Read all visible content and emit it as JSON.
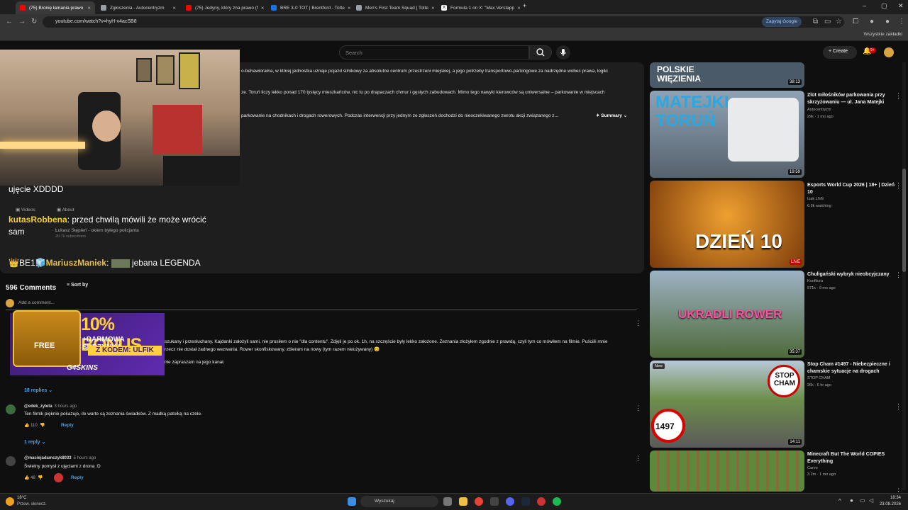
{
  "browser": {
    "tabs": [
      {
        "label": "(75) Bronię łamania prawo",
        "active": true,
        "color": "#ff0000"
      },
      {
        "label": "Zgłoszenia - Autocentryzm",
        "active": false,
        "color": "#9aa0a6"
      },
      {
        "label": "(75) Jedyny, który zna prawo (f",
        "active": false,
        "color": "#ff0000"
      },
      {
        "label": "BRE 3-0 TOT | Brentford - Totte",
        "active": false,
        "color": "#1a73e8"
      },
      {
        "label": "Men's First Team Squad | Totte",
        "active": false,
        "color": "#9aa0a6"
      },
      {
        "label": "Formula 1 on X: \"Max Verstapp",
        "active": false,
        "color": "#ffffff"
      }
    ],
    "new_tab": "+",
    "url": "youtube.com/watch?v=hyH-v4acSB8",
    "google_button": "Zapytaj Google",
    "bookmarks_all": "Wszystkie zakładki"
  },
  "youtube": {
    "search_placeholder": "Search",
    "create_label": "Create",
    "bell_badge": "9+",
    "description_lines": [
      "o-behawioralna, w której jednostka uznaje pojazd silnikowy za absolutne centrum przestrzeni miejskiej, a jego potrzeby transportowo-parkingowe za nadrzędne wobec prawa, logiki",
      "ze. Toruń liczy lekko ponad 170 tysięcy mieszkańców, nic tu po drapaczach chmur i gęstych zabudowach. Mimo tego nawyki kierowców są uniwersalne – parkowanie w miejscach",
      "parkowanie na chodnikach i drogach rowerowych. Podczas interwencji przy jednym ze zgłoszeń dochodzi do nieoczekiwanego zwrotu akcji związanego z..."
    ],
    "summary_label": "Summary",
    "channel_tabs": [
      "Videos",
      "About"
    ],
    "channel_name": "Łukasz Stępień - okiem byłego policjanta",
    "channel_subs": "20.7k subscribers",
    "comments_count": "596 Comments",
    "sort_by": "Sort by",
    "add_comment": "Add a comment...",
    "comments": [
      {
        "lines": [
          "szukany i przesłuchany. Kajdanki założyli sami, nie prosiłem o nie \"dla contentu\". Zdjęli je po ok. 1h, na szczęście były lekko założone. Zeznania złożyłem zgodnie z prawdą, czyli tym co mówiłem na filmie. Puściili mnie",
          "rzecz nie dostał żadnego wezwania. Rower skonfiskowany, zbieram na nowy (tym razem nieużywany) 😊",
          "nie zapraszam na jego kanał."
        ],
        "replies": "18 replies"
      },
      {
        "author": "@edek_zyleta",
        "time": "3 hours ago",
        "text": "Ten filmik pięknie pokazuje, ile warte są zeznania świadków. Z madką patolką na czele.",
        "likes": "110",
        "reply_label": "Reply",
        "replies": "1 reply"
      },
      {
        "author": "@maciejadamczyk8033",
        "time": "5 hours ago",
        "text": "Świetny pomysł z ujęciami z drona :D",
        "likes": "48",
        "reply_label": "Reply"
      }
    ]
  },
  "stream_overlay": {
    "chat": [
      {
        "text": "ujęcie XDDDD"
      },
      {
        "user": "kutasRobbena",
        "text": ": przed chwilą mówili że może wrócić sam"
      },
      {
        "badges": "👑BE1🧊",
        "user": "MariuszManiek",
        "text": "jebana LEGENDA"
      }
    ],
    "promo": {
      "big": "10% BONUS",
      "sub": "+DARMOWA SKRZYNKA",
      "code": "Z KODEM: ULFIK",
      "free": "FREE",
      "logo": "G4SKINS"
    }
  },
  "sidebar_videos": [
    {
      "thumb_text": "POLSKIE WIĘZIENIA",
      "duration": "38:13",
      "color": "#3b4252"
    },
    {
      "thumb_text": "MATEJKI TORUŃ",
      "duration": "19:59",
      "title": "Zlot miłośników parkowania przy skrzyżowaniu — ul. Jana Matejki",
      "channel": "Autocentryzm",
      "meta": "29k · 1 mo ago",
      "color": "#6a7a88"
    },
    {
      "thumb_text": "DZIEŃ 10",
      "duration": "LIVE",
      "title": "Esports World Cup 2026 | 18+ | Dzień 10",
      "channel": "Izak LIVE",
      "meta": "6.9k watching",
      "color": "#b4621a"
    },
    {
      "thumb_text": "UKRADLI ROWER",
      "duration": "35:37",
      "title": "Chuligański wybryk nieobcyjczany",
      "channel": "Konfitura",
      "meta": "571k · 9 mo ago",
      "color": "#5f7a44"
    },
    {
      "thumb_text": "STOP CHAM",
      "duration": "14:11",
      "title": "Stop Cham #1497 - Niebezpieczne i chamskie sytuacje na drogach",
      "channel": "STOP CHAM",
      "meta": "26k · 6 hr ago",
      "badge": "New",
      "speed": "1497",
      "color": "#667f4a"
    },
    {
      "thumb_text": "",
      "duration": "",
      "title": "Minecraft But The World COPIES Everything",
      "channel": "Carvo",
      "meta": "3.2m · 1 mo ago",
      "color": "#5d8a3a"
    }
  ],
  "taskbar": {
    "temp": "18°C",
    "weather": "Przew. słonecz.",
    "search": "Wyszukaj",
    "time": "18:34",
    "date": "23.08.2026"
  }
}
